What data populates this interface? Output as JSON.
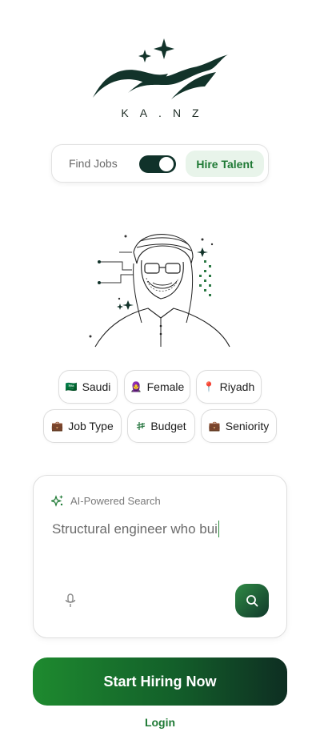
{
  "brand": {
    "logo_text": "KA.NZ"
  },
  "mode_toggle": {
    "left_label": "Find Jobs",
    "right_label": "Hire Talent",
    "state": "Hire Talent"
  },
  "filters": [
    {
      "icon": "flag-saudi-icon",
      "emoji": "🇸🇦",
      "label": "Saudi"
    },
    {
      "icon": "woman-hijab-icon",
      "emoji": "🧕",
      "label": "Female"
    },
    {
      "icon": "location-pin-icon",
      "emoji": "📍",
      "label": "Riyadh"
    },
    {
      "icon": "briefcase-icon",
      "emoji": "💼",
      "label": "Job Type"
    },
    {
      "icon": "riyal-currency-icon",
      "emoji": "⃁",
      "label": "Budget"
    },
    {
      "icon": "briefcase-icon",
      "emoji": "💼",
      "label": "Seniority"
    }
  ],
  "search": {
    "label": "AI-Powered Search",
    "query": "Structural engineer who bui"
  },
  "cta": {
    "label": "Start Hiring Now"
  },
  "login": {
    "label": "Login"
  },
  "colors": {
    "accent_green": "#1f7a35",
    "dark_green": "#10322a",
    "pill_bg": "#e8f4ea"
  }
}
